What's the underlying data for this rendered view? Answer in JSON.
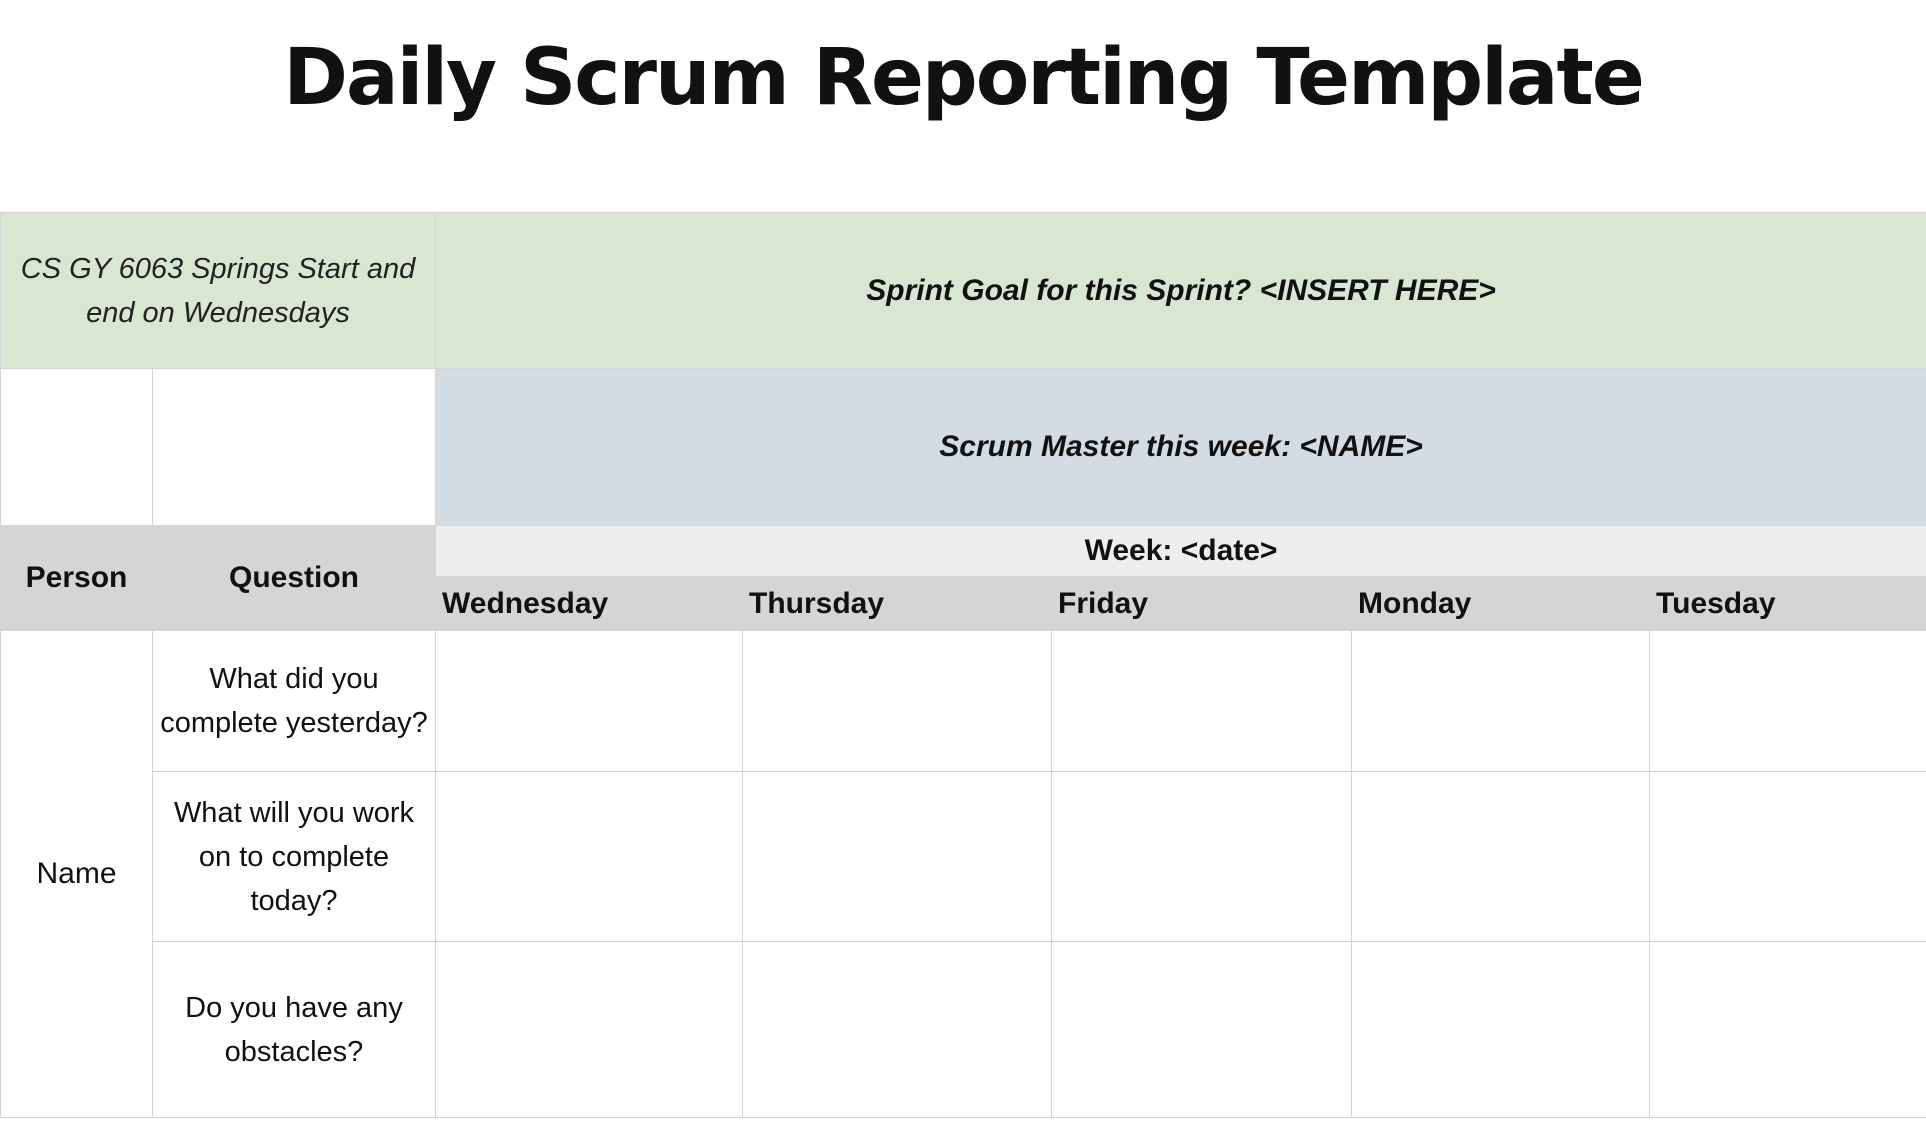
{
  "document": {
    "title": "Daily Scrum Reporting Template"
  },
  "header": {
    "course_note": "CS GY 6063 Springs Start and end on Wednesdays",
    "sprint_goal": "Sprint Goal for this Sprint? <INSERT HERE>",
    "scrum_master": "Scrum Master this week: <NAME>",
    "week_label": "Week: <date>"
  },
  "table": {
    "columns": {
      "person": "Person",
      "question": "Question",
      "days": [
        "Wednesday",
        "Thursday",
        "Friday",
        "Monday",
        "Tuesday"
      ]
    },
    "person": "Name",
    "questions": [
      "What did you complete yesterday?",
      "What will you work on to complete today?",
      "Do you have any obstacles?"
    ],
    "answers": [
      [
        "",
        "",
        "",
        "",
        ""
      ],
      [
        "",
        "",
        "",
        "",
        ""
      ],
      [
        "",
        "",
        "",
        "",
        ""
      ]
    ]
  },
  "colors": {
    "sprint_band": "#d9e7d2",
    "scrum_master_band": "#d2dce2",
    "header_band": "#d5d4d7",
    "week_band": "#eeeef0",
    "gridline": "#d4d4d4"
  }
}
